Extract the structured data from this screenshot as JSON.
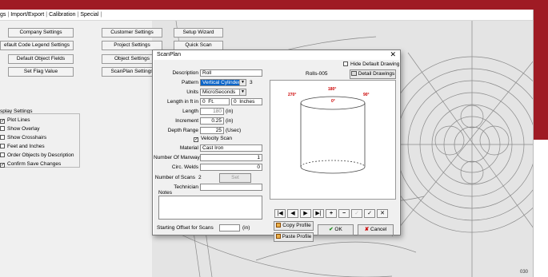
{
  "menu": [
    "gs",
    "Import/Export",
    "Calibration",
    "Special"
  ],
  "left_buttons": {
    "company_settings": "Company Settings",
    "default_code_legend": "efault Code Legend Settings",
    "default_object_fields": "Default Object Fields",
    "set_flag_value": "Set Flag Value"
  },
  "mid_buttons": {
    "customer_settings": "Customer Settings",
    "project_settings": "Project Settings",
    "object_settings": "Object Settings",
    "scanplan_settings": "ScanPlan Settings",
    "setup_wizard": "Setup Wizard",
    "quick_scan": "Quick Scan"
  },
  "display_settings": {
    "title": "splay Settings",
    "items": [
      {
        "label": "Plot Lines",
        "checked": true
      },
      {
        "label": "Show Overlay",
        "checked": false
      },
      {
        "label": "Show Crosshairs",
        "checked": false
      },
      {
        "label": "Feet and Inches",
        "checked": false
      },
      {
        "label": "Order Objects by Description",
        "checked": false
      },
      {
        "label": "Confirm Save Changes",
        "checked": true
      }
    ]
  },
  "dialog": {
    "title": "ScanPlan",
    "close": "✕",
    "description_label": "Description",
    "description_value": "Roll",
    "pattern_label": "Pattern",
    "pattern_value": "Vertical Cylinder",
    "pattern_number": "3",
    "units_label": "Units",
    "units_value": "MicroSeconds",
    "length_ft_in_label": "Length in ft in",
    "length_ft_value": "0",
    "length_ft_unit": "Ft.",
    "length_in_value": "0",
    "length_in_unit": "Inches",
    "length_label": "Length",
    "length_value": "180",
    "length_unit": "(in)",
    "increment_label": "Increment",
    "increment_value": "0.25",
    "increment_unit": "(in)",
    "depth_range_label": "Depth Range",
    "depth_range_value": "25",
    "depth_range_unit": "(Usec)",
    "velocity_scan_label": "Velocity Scan",
    "material_label": "Material",
    "material_value": "Cast Iron",
    "manways_label": "Number Of Manways",
    "manways_value": "1",
    "circ_welds_label": "Circ. Welds",
    "circ_welds_value": "0",
    "num_scans_label": "Number of Scans",
    "num_scans_value": "2",
    "set_label": "Set",
    "technician_label": "Technician",
    "technician_value": "",
    "notes_label": "Notes",
    "starting_offset_label": "Starting Offset for Scans",
    "starting_offset_unit": "(in)",
    "hide_default_drawing": "Hide Default Drawing",
    "drawing_name": "Rolls-005",
    "detail_drawings": "Detail Drawings",
    "angle_180": "180°",
    "angle_270": "270°",
    "angle_90": "90°",
    "angle_0": "0°",
    "nav_buttons": [
      "|◀",
      "◀",
      "▶",
      "▶|",
      "+",
      "−",
      "✓",
      "✓",
      "✕"
    ],
    "copy_profile": "Copy Profile",
    "paste_profile": "Paste Profile",
    "ok": "OK",
    "cancel": "Cancel"
  },
  "page_number": "030",
  "colors": {
    "red_band": "#9f1b24",
    "selection": "#0a64c8",
    "angle_text": "#cc0000",
    "ok_check": "#1a8a1a",
    "cancel_x": "#cc0000"
  }
}
